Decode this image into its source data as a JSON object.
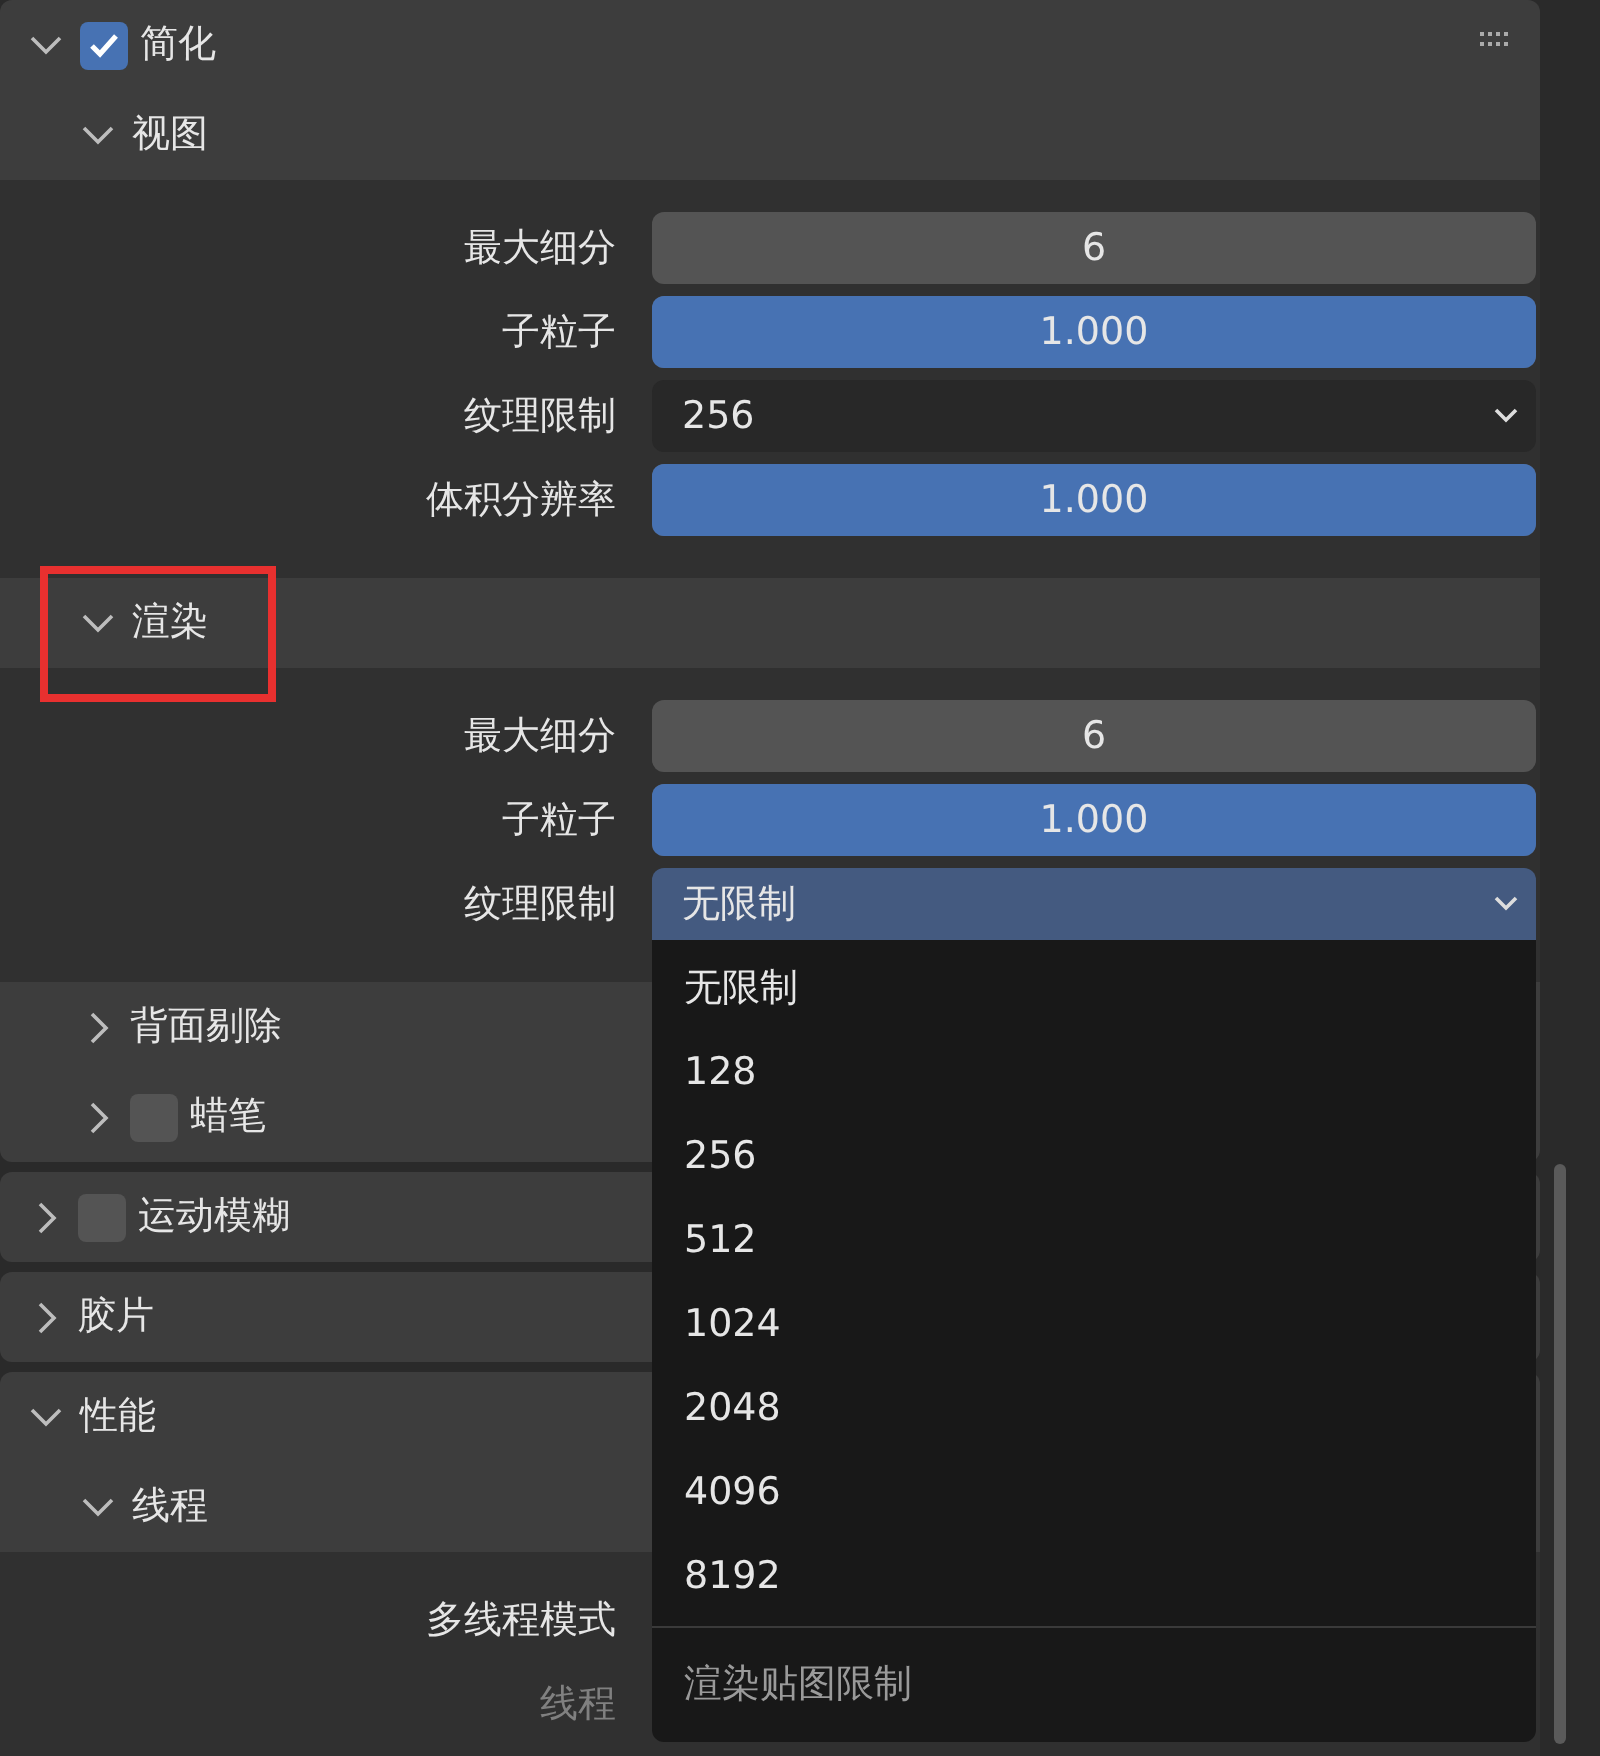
{
  "panels": [
    {
      "title": "简化",
      "expanded": true,
      "checked": true,
      "grip": true,
      "subpanels": [
        {
          "title": "视图",
          "expanded": true,
          "rows": [
            {
              "label": "最大细分",
              "kind": "number",
              "value": "6"
            },
            {
              "label": "子粒子",
              "kind": "slider",
              "value": "1.000",
              "level": 1
            },
            {
              "label": "纹理限制",
              "kind": "dropdown",
              "value": "256",
              "open": false
            },
            {
              "label": "体积分辨率",
              "kind": "slider",
              "value": "1.000",
              "level": 1
            }
          ]
        },
        {
          "title": "渲染",
          "expanded": true,
          "highlighted": true,
          "rows": [
            {
              "label": "最大细分",
              "kind": "number",
              "value": "6"
            },
            {
              "label": "子粒子",
              "kind": "slider",
              "value": "1.000",
              "level": 1
            },
            {
              "label": "纹理限制",
              "kind": "dropdown",
              "value": "无限制",
              "open": true,
              "menu": {
                "items": [
                  "无限制",
                  "128",
                  "256",
                  "512",
                  "1024",
                  "2048",
                  "4096",
                  "8192"
                ],
                "hint": "渲染贴图限制"
              }
            }
          ]
        },
        {
          "title": "背面剔除",
          "expanded": false
        },
        {
          "title": "蜡笔",
          "expanded": false,
          "checked": false
        }
      ]
    },
    {
      "title": "运动模糊",
      "expanded": false,
      "checked": false
    },
    {
      "title": "胶片",
      "expanded": false
    },
    {
      "title": "性能",
      "expanded": true,
      "subpanels": [
        {
          "title": "线程",
          "expanded": true,
          "rows": [
            {
              "label": "多线程模式",
              "kind": "covered",
              "disabled": false
            },
            {
              "label": "线程",
              "kind": "covered",
              "disabled": true
            }
          ]
        }
      ]
    }
  ]
}
